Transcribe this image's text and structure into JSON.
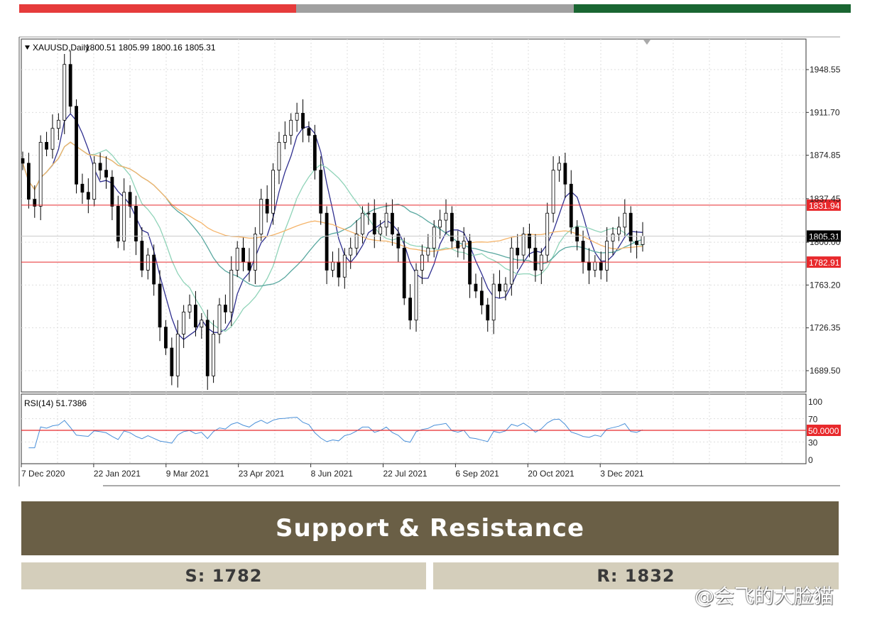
{
  "header_colors": [
    "#e63b3b",
    "#a0a0a0",
    "#1a6632"
  ],
  "chart_data": {
    "type": "candlestick",
    "title": "XAUUSD,Daily",
    "ohlc_readout": "1800.51 1805.99 1800.16 1805.31",
    "y_ticks": [
      "1948.55",
      "1911.70",
      "1874.85",
      "1837.45",
      "1800.00",
      "1763.20",
      "1726.35",
      "1689.50"
    ],
    "ylim": [
      1665,
      1978
    ],
    "x_ticks": [
      "7 Dec 2020",
      "22 Jan 2021",
      "9 Mar 2021",
      "23 Apr 2021",
      "8 Jun 2021",
      "22 Jul 2021",
      "6 Sep 2021",
      "20 Oct 2021",
      "3 Dec 2021"
    ],
    "closes": [
      1868,
      1837,
      1831,
      1886,
      1880,
      1898,
      1905,
      1953,
      1917,
      1850,
      1843,
      1837,
      1868,
      1862,
      1856,
      1831,
      1801,
      1843,
      1831,
      1801,
      1776,
      1789,
      1764,
      1727,
      1709,
      1685,
      1721,
      1740,
      1746,
      1727,
      1733,
      1685,
      1721,
      1746,
      1740,
      1776,
      1795,
      1783,
      1776,
      1807,
      1837,
      1825,
      1862,
      1886,
      1892,
      1905,
      1911,
      1898,
      1892,
      1862,
      1825,
      1776,
      1783,
      1770,
      1789,
      1795,
      1807,
      1825,
      1825,
      1807,
      1813,
      1825,
      1807,
      1795,
      1752,
      1733,
      1776,
      1789,
      1795,
      1813,
      1819,
      1825,
      1801,
      1795,
      1801,
      1764,
      1758,
      1746,
      1733,
      1764,
      1758,
      1764,
      1795,
      1789,
      1807,
      1795,
      1776,
      1789,
      1825,
      1862,
      1868,
      1850,
      1813,
      1801,
      1783,
      1776,
      1783,
      1776,
      1801,
      1807,
      1813,
      1825,
      1801,
      1798,
      1805.31
    ],
    "lines": [
      {
        "label": "1831.94",
        "value": 1831.94,
        "color": "#e8292c"
      },
      {
        "label": "1782.91",
        "value": 1782.91,
        "color": "#e8292c"
      }
    ],
    "current_price": {
      "label": "1805.31",
      "value": 1805.31
    },
    "moving_average_colors": [
      "#2f2f8f",
      "#8fd3b8",
      "#5aa8a0",
      "#f5b46a"
    ],
    "rsi": {
      "label": "RSI(14) 51.7386",
      "ticks": [
        "100",
        "70",
        "30",
        "0"
      ],
      "level_label": "50.0000",
      "level": 50,
      "line_color": "#4a90d9"
    }
  },
  "banner": {
    "title": "Support & Resistance"
  },
  "levels": {
    "support": "S: 1782",
    "resistance": "R: 1832"
  },
  "watermark": "@会飞的大脸猫"
}
